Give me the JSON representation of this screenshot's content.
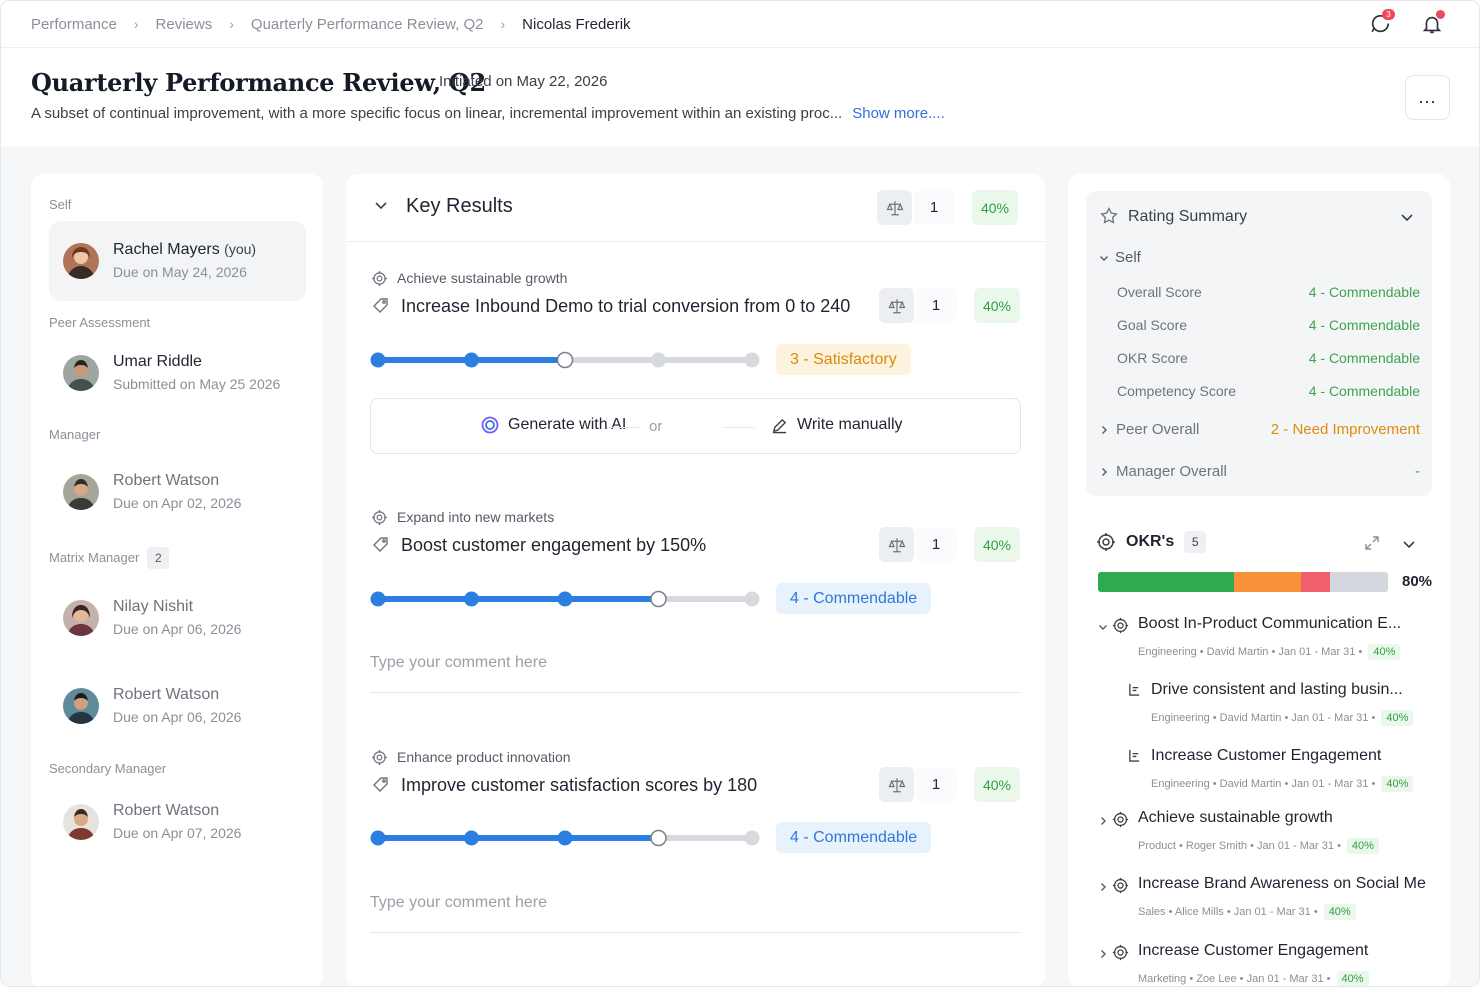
{
  "breadcrumb": [
    "Performance",
    "Reviews",
    "Quarterly Performance Review, Q2",
    "Nicolas Frederik"
  ],
  "top_icons": {
    "chat_badge": "3"
  },
  "header": {
    "title": "Quarterly Performance Review, Q2",
    "initiated": "Initiated on May 22, 2026",
    "description": "A subset of continual improvement, with a more specific focus on linear, incremental improvement within an existing proc...",
    "show_more": "Show more....",
    "more_button": "..."
  },
  "reviewers": {
    "self_label": "Self",
    "self": {
      "name": "Rachel Mayers",
      "you": "(you)",
      "sub": "Due on May 24, 2026"
    },
    "peer_label": "Peer Assessment",
    "peer": {
      "name": "Umar Riddle",
      "sub": "Submitted on May 25 2026"
    },
    "manager_label": "Manager",
    "manager": {
      "name": "Robert Watson",
      "sub": "Due on Apr 02, 2026"
    },
    "matrix_label": "Matrix Manager",
    "matrix_count": "2",
    "matrix": [
      {
        "name": "Nilay Nishit",
        "sub": "Due on Apr 06, 2026"
      },
      {
        "name": "Robert Watson",
        "sub": "Due on Apr 06, 2026"
      }
    ],
    "secondary_label": "Secondary Manager",
    "secondary": {
      "name": "Robert Watson",
      "sub": "Due on Apr 07, 2026"
    }
  },
  "key_results": {
    "title": "Key Results",
    "weight": "1",
    "percent": "40%",
    "items": [
      {
        "goal": "Achieve sustainable growth",
        "title": "Increase Inbound Demo to trial conversion from 0 to 240",
        "weight": "1",
        "percent": "40%",
        "rating": "3 - Satisfactory",
        "level": 3,
        "generate_ai": "Generate with AI",
        "or": "or",
        "write_manually": "Write manually"
      },
      {
        "goal": "Expand into new markets",
        "title": "Boost customer engagement by 150%",
        "weight": "1",
        "percent": "40%",
        "rating": "4 - Commendable",
        "level": 4,
        "comment_placeholder": "Type your comment here"
      },
      {
        "goal": "Enhance product innovation",
        "title": "Improve customer satisfaction scores by 180",
        "weight": "1",
        "percent": "40%",
        "rating": "4 - Commendable",
        "level": 4,
        "comment_placeholder": "Type your comment here"
      }
    ]
  },
  "rating_summary": {
    "title": "Rating Summary",
    "self_label": "Self",
    "rows": [
      {
        "label": "Overall Score",
        "value": "4 - Commendable"
      },
      {
        "label": "Goal Score",
        "value": "4 - Commendable"
      },
      {
        "label": "OKR Score",
        "value": "4 - Commendable"
      },
      {
        "label": "Competency Score",
        "value": "4 - Commendable"
      }
    ],
    "peer_label": "Peer Overall",
    "peer_value": "2 - Need Improvement",
    "manager_label": "Manager Overall",
    "manager_value": "-",
    "colors": {
      "good": "#3fa34d",
      "warn": "#e08a12"
    }
  },
  "okrs": {
    "title": "OKR's",
    "count": "5",
    "progress": "80%",
    "bar_segments": [
      {
        "color": "#2eab4f",
        "fraction": 0.47
      },
      {
        "color": "#f7923a",
        "fraction": 0.23
      },
      {
        "color": "#f0606a",
        "fraction": 0.1
      },
      {
        "color": "#d4d8de",
        "fraction": 0.2
      }
    ],
    "items": [
      {
        "title": "Boost In-Product Communication E...",
        "meta": "Engineering • David Martin • Jan 01 - Mar 31 •",
        "percent": "40%"
      },
      {
        "title": "Drive consistent and lasting busin...",
        "meta": "Engineering • David Martin • Jan 01 - Mar 31 •",
        "percent": "40%"
      },
      {
        "title": "Increase Customer Engagement",
        "meta": "Engineering • David Martin • Jan 01 - Mar 31 •",
        "percent": "40%"
      },
      {
        "title": "Achieve sustainable growth",
        "meta": "Product • Roger Smith • Jan 01 - Mar 31 •",
        "percent": "40%"
      },
      {
        "title": "Increase Brand Awareness on Social Me",
        "meta": "Sales • Alice Mills • Jan 01 - Mar 31 •",
        "percent": "40%"
      },
      {
        "title": "Increase Customer Engagement",
        "meta": "Marketing • Zoe Lee • Jan 01 - Mar 31 •",
        "percent": "40%"
      }
    ]
  }
}
